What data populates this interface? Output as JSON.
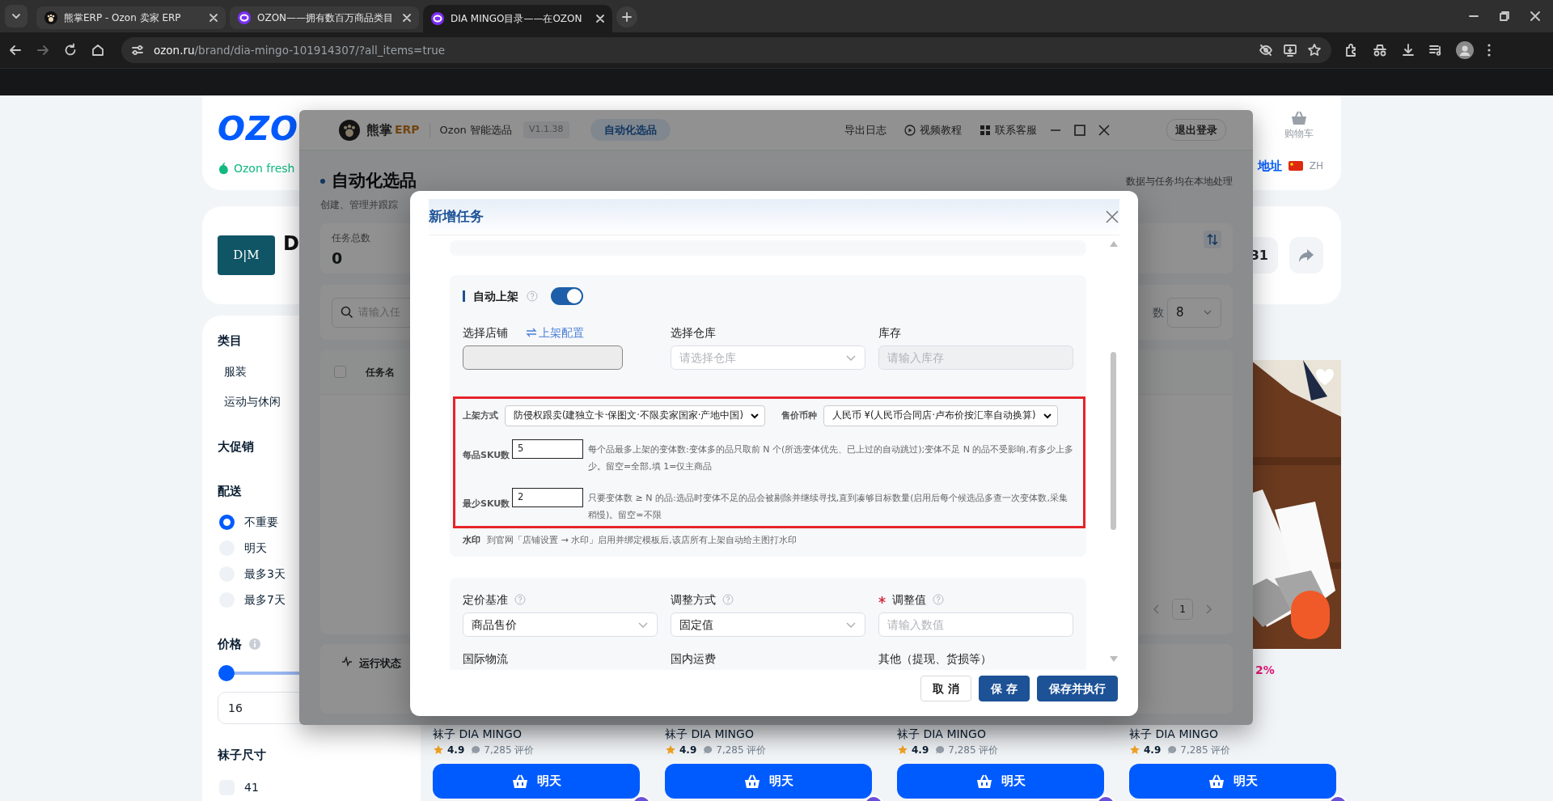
{
  "browser": {
    "tabs": [
      {
        "title": "熊掌ERP - Ozon 卖家 ERP",
        "selected": false
      },
      {
        "title": "OZON——拥有数百万商品类目",
        "selected": false
      },
      {
        "title": "DIA MINGO目录——在OZON",
        "selected": true
      }
    ],
    "url_host": "ozon.ru",
    "url_path": "/brand/dia-mingo-101914307/?all_items=true"
  },
  "ozon_page": {
    "logo": "OZO",
    "fresh_link": "Ozon fresh",
    "cart_label": "购物车",
    "address_link": "地址",
    "language": "ZH",
    "brand_logo_text": "D|M",
    "brand_initial": "D",
    "likes_count": "31",
    "filters": {
      "category_title": "类目",
      "categories": [
        "服装",
        "运动与休闲"
      ],
      "promo_title": "大促销",
      "delivery_title": "配送",
      "delivery_options": [
        {
          "label": "不重要",
          "selected": true
        },
        {
          "label": "明天",
          "selected": false
        },
        {
          "label": "最多3天",
          "selected": false
        },
        {
          "label": "最多7天",
          "selected": false
        }
      ],
      "price_title": "价格",
      "price_slider": {
        "level": 0
      },
      "price_min": "16",
      "size_title": "袜子尺寸",
      "sizes": [
        {
          "label": "41",
          "checked": false
        }
      ]
    },
    "products": [
      {
        "title": "袜子 DIA MINGO",
        "rating": "4.9",
        "reviews": "7,285 评价",
        "button": "明天"
      },
      {
        "title": "袜子 DIA MINGO",
        "rating": "4.9",
        "reviews": "7,285 评价",
        "button": "明天"
      },
      {
        "title": "袜子 DIA MINGO",
        "rating": "4.9",
        "reviews": "7,285 评价",
        "button": "明天"
      },
      {
        "discount": "2%",
        "title": "袜子 DIA MINGO",
        "rating": "4.9",
        "reviews": "7,285 评价",
        "button": "明天"
      }
    ]
  },
  "erp": {
    "brand_name": "熊掌",
    "brand_suffix": "ERP",
    "app_name": "Ozon 智能选品",
    "version": "V1.1.38",
    "nav": [
      {
        "label": "自动化选品",
        "selected": true
      }
    ],
    "actions": [
      {
        "label": "导出日志",
        "kind": "text"
      },
      {
        "label": "视频教程",
        "kind": "video"
      },
      {
        "label": "联系客服",
        "kind": "support"
      }
    ],
    "logout": "退出登录",
    "page_title": "自动化选品",
    "page_subtitle": "创建、管理并跟踪",
    "note": "数据与任务均在本地处理",
    "stats": [
      {
        "label": "任务总数",
        "value": "0"
      }
    ],
    "search_placeholder": "请输入任",
    "count_label": "数",
    "count_value": "8",
    "select_all_checked": false,
    "table_columns": [
      "任务名"
    ],
    "page": "1",
    "status_title": "运行状态"
  },
  "modal": {
    "title": "新增任务",
    "auto_listing": {
      "label": "自动上架",
      "on": true,
      "store": {
        "label": "选择店铺",
        "link": "上架配置"
      },
      "warehouse": {
        "label": "选择仓库",
        "placeholder": "请选择仓库"
      },
      "stock": {
        "label": "库存",
        "placeholder": "请输入库存",
        "disabled": true
      },
      "listing_mode": {
        "label": "上架方式",
        "value": "防侵权跟卖(建独立卡·保图文·不限卖家国家·产地中国)"
      },
      "currency": {
        "label": "售价币种",
        "value": "人民币 ¥(人民币合同店·卢布价按汇率自动换算)"
      },
      "sku_rows": [
        {
          "label": "每品SKU数",
          "value": "5",
          "hint": "每个品最多上架的变体数:变体多的品只取前 N 个(所选变体优先、已上过的自动跳过);变体不足 N 的品不受影响,有多少上多少。留空=全部,填 1=仅主商品"
        },
        {
          "label": "最少SKU数",
          "value": "2",
          "hint": "只要变体数 ≥ N 的品:选品时变体不足的品会被剔除并继续寻找,直到凑够目标数量(启用后每个候选品多查一次变体数,采集稍慢)。留空=不限"
        }
      ],
      "watermark": {
        "label": "水印",
        "text": "到官网「店铺设置 → 水印」启用并绑定模板后,该店所有上架自动给主图打水印"
      }
    },
    "pricing": {
      "fields": [
        {
          "label": "定价基准",
          "kind": "select",
          "value": "商品售价",
          "required": false
        },
        {
          "label": "调整方式",
          "kind": "select",
          "value": "固定值",
          "required": false
        },
        {
          "label": "调整值",
          "kind": "input",
          "placeholder": "请输入数值",
          "required": true
        }
      ],
      "more_labels": [
        "国际物流",
        "国内运费",
        "其他（提现、货损等）"
      ]
    },
    "buttons": [
      {
        "label": "取 消",
        "kind": "default"
      },
      {
        "label": "保 存",
        "kind": "primary"
      },
      {
        "label": "保存并执行",
        "kind": "primary"
      }
    ]
  }
}
